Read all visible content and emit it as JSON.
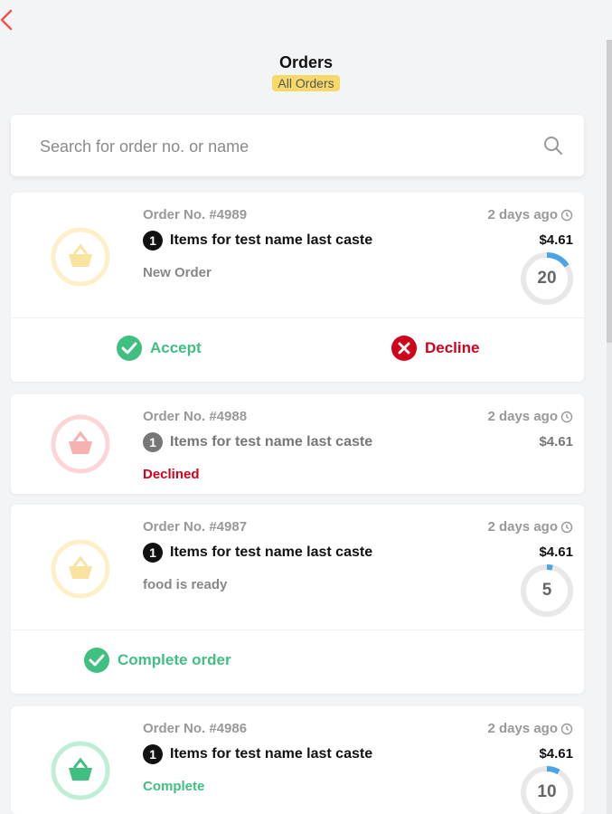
{
  "header": {
    "title": "Orders",
    "filter_badge": "All Orders"
  },
  "search": {
    "placeholder": "Search for order no. or name",
    "value": ""
  },
  "orders": [
    {
      "order_no": "Order No. #4989",
      "item_count": "1",
      "items_label": "Items for test name last caste",
      "status": "New Order",
      "time": "2 days ago",
      "price": "$4.61",
      "timer": "20",
      "actions": {
        "accept": "Accept",
        "decline": "Decline"
      }
    },
    {
      "order_no": "Order No. #4988",
      "item_count": "1",
      "items_label": "Items for test name last caste",
      "status": "Declined",
      "time": "2 days ago",
      "price": "$4.61"
    },
    {
      "order_no": "Order No. #4987",
      "item_count": "1",
      "items_label": "Items for test name last caste",
      "status": "food is ready",
      "time": "2 days ago",
      "price": "$4.61",
      "timer": "5",
      "actions": {
        "complete": "Complete order"
      }
    },
    {
      "order_no": "Order No. #4986",
      "item_count": "1",
      "items_label": "Items for test name last caste",
      "status": "Complete",
      "time": "2 days ago",
      "price": "$4.61",
      "timer": "10"
    }
  ],
  "colors": {
    "accent_green": "#3fbf80",
    "decline_red": "#d0021b",
    "badge_yellow": "#f7d96a",
    "timer_blue": "#4aa3e8",
    "back_red": "#f05454"
  },
  "icons": [
    "back-arrow-icon",
    "search-icon",
    "basket-icon",
    "clock-icon",
    "check-circle-icon",
    "x-circle-icon"
  ]
}
